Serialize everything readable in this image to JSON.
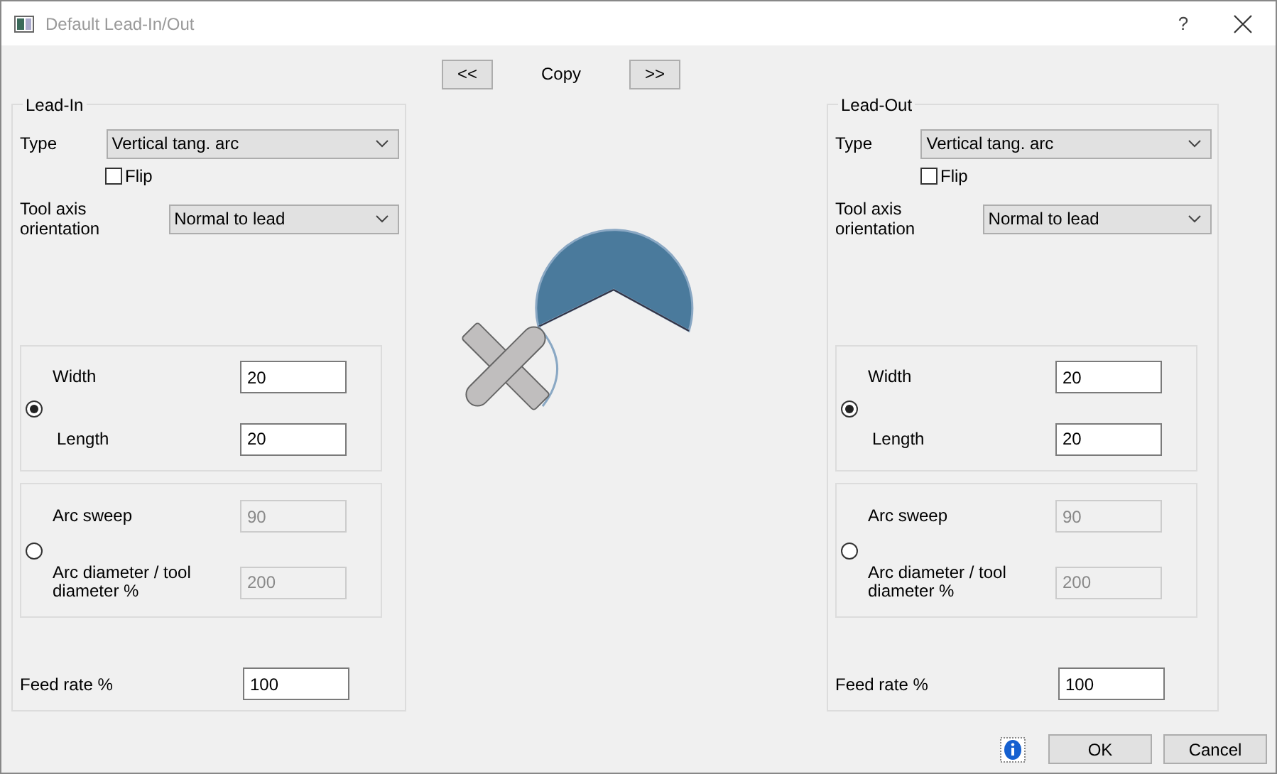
{
  "window": {
    "title": "Default Lead-In/Out",
    "help": "?"
  },
  "copy": {
    "left": "<<",
    "label": "Copy",
    "right": ">>"
  },
  "panels": [
    {
      "title": "Lead-In",
      "type": {
        "label": "Type",
        "value": "Vertical tang. arc"
      },
      "flip": {
        "label": "Flip",
        "checked": false
      },
      "tool_axis": {
        "label": "Tool axis orientation",
        "value": "Normal to lead"
      },
      "options": [
        {
          "selected": true,
          "fields": [
            {
              "label": "Width",
              "value": "20",
              "disabled": false
            },
            {
              "label": "Length",
              "value": "20",
              "disabled": false
            }
          ]
        },
        {
          "selected": false,
          "fields": [
            {
              "label": "Arc sweep",
              "value": "90",
              "disabled": true
            },
            {
              "label": "Arc diameter / tool diameter %",
              "value": "200",
              "disabled": true
            }
          ]
        }
      ],
      "feed_rate": {
        "label": "Feed rate %",
        "value": "100"
      }
    },
    {
      "title": "Lead-Out",
      "type": {
        "label": "Type",
        "value": "Vertical tang. arc"
      },
      "flip": {
        "label": "Flip",
        "checked": false
      },
      "tool_axis": {
        "label": "Tool axis orientation",
        "value": "Normal to lead"
      },
      "options": [
        {
          "selected": true,
          "fields": [
            {
              "label": "Width",
              "value": "20",
              "disabled": false
            },
            {
              "label": "Length",
              "value": "20",
              "disabled": false
            }
          ]
        },
        {
          "selected": false,
          "fields": [
            {
              "label": "Arc sweep",
              "value": "90",
              "disabled": true
            },
            {
              "label": "Arc diameter / tool diameter %",
              "value": "200",
              "disabled": true
            }
          ]
        }
      ],
      "feed_rate": {
        "label": "Feed rate %",
        "value": "100"
      }
    }
  ],
  "buttons": [
    {
      "label": "OK"
    },
    {
      "label": "Cancel"
    }
  ]
}
